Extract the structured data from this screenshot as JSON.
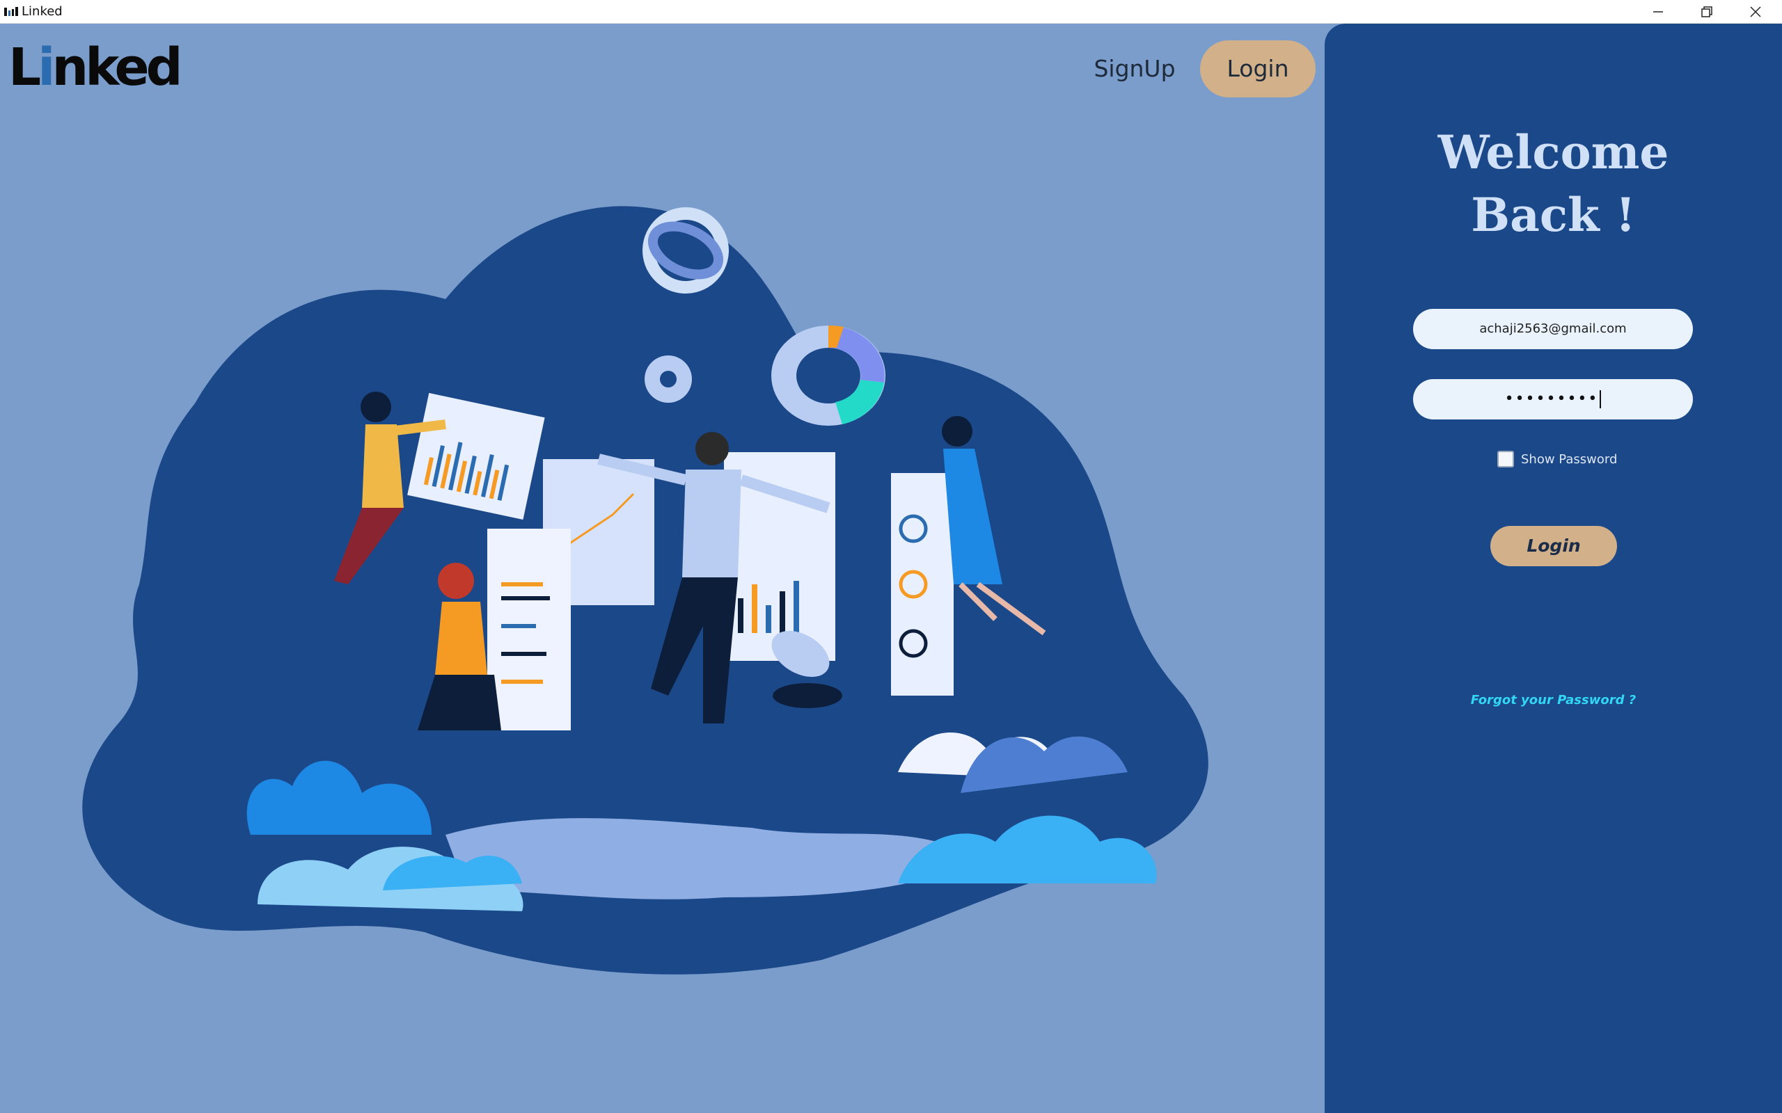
{
  "window": {
    "title": "Linked",
    "controls": [
      "minimize-icon",
      "restore-icon",
      "close-icon"
    ]
  },
  "header": {
    "logo_first": "L",
    "logo_i": "i",
    "logo_rest": "nked",
    "signup_label": "SignUp",
    "login_label": "Login"
  },
  "illustration": {
    "icon": "team-analytics-illustration"
  },
  "login_panel": {
    "welcome_line1": "Welcome",
    "welcome_line2": "Back !",
    "email_value": "achaji2563@gmail.com",
    "password_mask": "•••••••••",
    "show_password_label": "Show Password",
    "show_password_checked": false,
    "login_button_label": "Login",
    "forgot_password_label": "Forgot your Password ?"
  },
  "colors": {
    "background": "#7b9dcb",
    "panel": "#1b4889",
    "accent_button": "#d2b08a",
    "link": "#33d6f4",
    "blob": "#1b4889"
  }
}
